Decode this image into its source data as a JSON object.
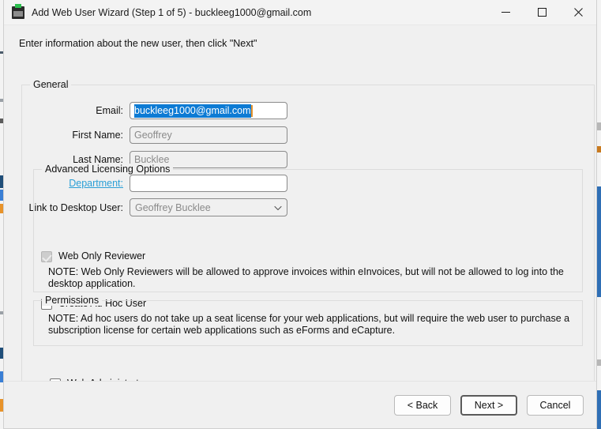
{
  "window": {
    "title": "Add Web User Wizard (Step 1 of 5) - buckleeg1000@gmail.com",
    "app_icon": "app-icon",
    "controls": {
      "minimize": "minimize-icon",
      "maximize": "maximize-icon",
      "close": "close-icon"
    }
  },
  "instruction": "Enter information about the new user, then click \"Next\"",
  "groups": {
    "general": {
      "label": "General"
    },
    "advanced": {
      "label": "Advanced Licensing Options"
    },
    "permissions": {
      "label": "Permissions"
    }
  },
  "fields": {
    "email": {
      "label": "Email:",
      "value": "buckleeg1000@gmail.com",
      "placeholder": "",
      "selected": true
    },
    "first_name": {
      "label": "First Name:",
      "value": "Geoffrey",
      "placeholder": ""
    },
    "last_name": {
      "label": "Last Name:",
      "value": "Bucklee",
      "placeholder": ""
    },
    "department": {
      "label": "Department:",
      "value": "",
      "placeholder": ""
    },
    "link_desktop_user": {
      "label": "Link to Desktop User:",
      "value": "Geoffrey  Bucklee",
      "chevron": "chevron-down-icon"
    }
  },
  "checkboxes": {
    "web_only_reviewer": {
      "label": "Web Only Reviewer",
      "checked": true,
      "disabled": true,
      "note": "NOTE: Web Only Reviewers will be allowed to approve invoices within eInvoices, but will not be allowed to log into the desktop application."
    },
    "create_ad_hoc_user": {
      "label": "Create Ad Hoc User",
      "checked": false,
      "disabled": false,
      "note": "NOTE: Ad hoc users do not take up a seat license for your web applications, but will require the web user to purchase a subscription license for certain web applications such as eForms and eCapture."
    },
    "web_administrator": {
      "label": "Web Administrator",
      "checked": false,
      "disabled": false
    }
  },
  "buttons": {
    "back": "< Back",
    "next": "Next >",
    "cancel": "Cancel"
  },
  "colors": {
    "selection_blue": "#0d7bd4",
    "link_blue": "#2a9fd6",
    "caret_orange": "#e8932a",
    "window_bg": "#f0f0f0",
    "titlebar_bg": "#f3f3f3"
  }
}
